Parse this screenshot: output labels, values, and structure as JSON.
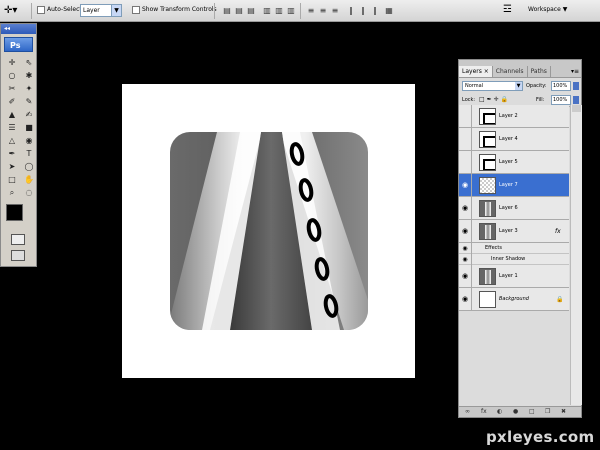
{
  "options_bar": {
    "tool_icon": "move-tool-icon",
    "auto_select_label": "Auto-Select:",
    "auto_select_checked": false,
    "auto_select_value": "Layer",
    "show_transform_label": "Show Transform Controls",
    "show_transform_checked": false,
    "workspace_label": "Workspace ▼"
  },
  "toolbox": {
    "grip_label": "◂◂",
    "app_badge": "Ps",
    "tools": [
      "✛",
      "⇖",
      "○",
      "✱",
      "✂",
      "✦",
      "✐",
      "✎",
      "▲",
      "✍",
      "☰",
      "■",
      "△",
      "◉",
      "✒",
      "T",
      "➤",
      "◯",
      "□",
      "✋",
      "⌕",
      "◌"
    ],
    "foreground_color": "#000000",
    "background_color": "#ffffff"
  },
  "layers_panel": {
    "tabs": [
      {
        "label": "Layers ×",
        "active": true
      },
      {
        "label": "Channels",
        "active": false
      },
      {
        "label": "Paths",
        "active": false
      }
    ],
    "menu_glyph": "▾≡",
    "blend_mode": "Normal",
    "opacity_label": "Opacity:",
    "opacity_value": "100%",
    "lock_label": "Lock:",
    "fill_label": "Fill:",
    "fill_value": "100%",
    "layers": [
      {
        "name": "Layer 2",
        "visible": false,
        "selected": false,
        "thumb": "sq"
      },
      {
        "name": "Layer 4",
        "visible": false,
        "selected": false,
        "thumb": "sq"
      },
      {
        "name": "Layer 5",
        "visible": false,
        "selected": false,
        "thumb": "sq"
      },
      {
        "name": "Layer 7",
        "visible": true,
        "selected": true,
        "thumb": "checker"
      },
      {
        "name": "Layer 6",
        "visible": true,
        "selected": false,
        "thumb": "road"
      },
      {
        "name": "Layer 3",
        "visible": true,
        "selected": false,
        "thumb": "road",
        "fx": "fx"
      },
      {
        "name": "Layer 1",
        "visible": true,
        "selected": false,
        "thumb": "road"
      },
      {
        "name": "Background",
        "visible": true,
        "selected": false,
        "thumb": "white",
        "locked": true
      }
    ],
    "effects_label": "Effects",
    "inner_shadow_label": "Inner Shadow",
    "bottom_icons": [
      "∞",
      "fx",
      "◐",
      "●",
      "□",
      "❐",
      "✖"
    ]
  },
  "watermark": "pxleyes.com"
}
